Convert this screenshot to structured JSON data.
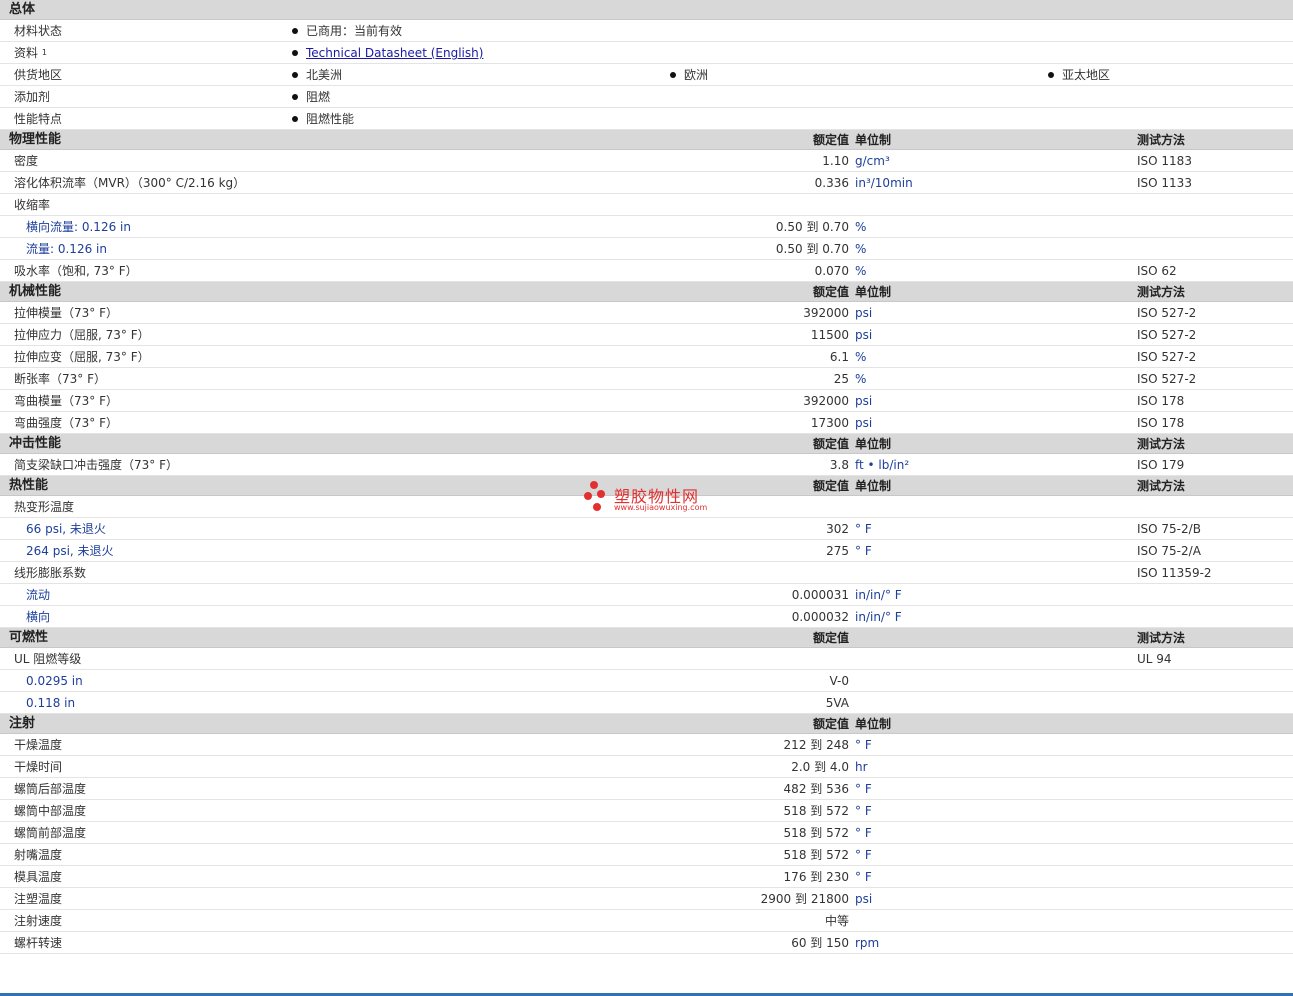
{
  "general": {
    "title": "总体",
    "rows": [
      {
        "label": "材料状态",
        "items": [
          "已商用：当前有效"
        ]
      },
      {
        "label": "资料",
        "sup": "1",
        "link": "Technical Datasheet (English)"
      },
      {
        "label": "供货地区",
        "items": [
          "北美洲",
          "欧洲",
          "亚太地区"
        ]
      },
      {
        "label": "添加剂",
        "items": [
          "阻燃"
        ]
      },
      {
        "label": "性能特点",
        "items": [
          "阻燃性能"
        ]
      }
    ]
  },
  "headers": {
    "value": "额定值",
    "unit": "单位制",
    "method": "测试方法"
  },
  "sections": [
    {
      "title": "物理性能",
      "show_unit": true,
      "show_method": true,
      "rows": [
        {
          "label": "密度",
          "value": "1.10",
          "unit": "g/cm³",
          "method": "ISO 1183"
        },
        {
          "label": "溶化体积流率（MVR）（300° C/2.16 kg）",
          "value": "0.336",
          "unit": "in³/10min",
          "method": "ISO 1133"
        },
        {
          "label": "收缩率",
          "value": "",
          "unit": "",
          "method": ""
        },
        {
          "label": "横向流量: 0.126 in",
          "sub": true,
          "value": "0.50 到  0.70",
          "unit": "%",
          "method": ""
        },
        {
          "label": "流量: 0.126 in",
          "sub": true,
          "value": "0.50 到  0.70",
          "unit": "%",
          "method": ""
        },
        {
          "label": "吸水率（饱和, 73° F）",
          "value": "0.070",
          "unit": "%",
          "method": "ISO 62"
        }
      ]
    },
    {
      "title": "机械性能",
      "show_unit": true,
      "show_method": true,
      "rows": [
        {
          "label": "拉伸模量（73° F）",
          "value": "392000",
          "unit": "psi",
          "method": "ISO 527-2"
        },
        {
          "label": "拉伸应力（屈服, 73° F）",
          "value": "11500",
          "unit": "psi",
          "method": "ISO 527-2"
        },
        {
          "label": "拉伸应变（屈服, 73° F）",
          "value": "6.1",
          "unit": "%",
          "method": "ISO 527-2"
        },
        {
          "label": "断张率（73° F）",
          "value": "25",
          "unit": "%",
          "method": "ISO 527-2"
        },
        {
          "label": "弯曲模量（73° F）",
          "value": "392000",
          "unit": "psi",
          "method": "ISO 178"
        },
        {
          "label": "弯曲强度（73° F）",
          "value": "17300",
          "unit": "psi",
          "method": "ISO 178"
        }
      ]
    },
    {
      "title": "冲击性能",
      "show_unit": true,
      "show_method": true,
      "rows": [
        {
          "label": "简支梁缺口冲击强度（73° F）",
          "value": "3.8",
          "unit": "ft • lb/in²",
          "method": "ISO 179"
        }
      ]
    },
    {
      "title": "热性能",
      "show_unit": true,
      "show_method": true,
      "rows": [
        {
          "label": "热变形温度",
          "value": "",
          "unit": "",
          "method": ""
        },
        {
          "label": "66 psi, 未退火",
          "sub": true,
          "value": "302",
          "unit": "° F",
          "method": "ISO 75-2/B"
        },
        {
          "label": "264 psi, 未退火",
          "sub": true,
          "value": "275",
          "unit": "° F",
          "method": "ISO 75-2/A"
        },
        {
          "label": "线形膨胀系数",
          "value": "",
          "unit": "",
          "method": "ISO 11359-2"
        },
        {
          "label": "流动",
          "sub": true,
          "value": "0.000031",
          "unit": "in/in/° F",
          "method": ""
        },
        {
          "label": "横向",
          "sub": true,
          "value": "0.000032",
          "unit": "in/in/° F",
          "method": ""
        }
      ]
    },
    {
      "title": "可燃性",
      "show_unit": false,
      "show_method": true,
      "rows": [
        {
          "label": "UL 阻燃等级",
          "value": "",
          "unit": "",
          "method": "UL 94"
        },
        {
          "label": "0.0295 in",
          "sub": true,
          "value": "V-0",
          "unit": "",
          "method": ""
        },
        {
          "label": "0.118 in",
          "sub": true,
          "value": "5VA",
          "unit": "",
          "method": ""
        }
      ]
    },
    {
      "title": "注射",
      "show_unit": true,
      "show_method": false,
      "rows": [
        {
          "label": "干燥温度",
          "value": "212 到  248",
          "unit": "° F",
          "method": ""
        },
        {
          "label": "干燥时间",
          "value": "2.0 到  4.0",
          "unit": "hr",
          "method": ""
        },
        {
          "label": "螺筒后部温度",
          "value": "482 到  536",
          "unit": "° F",
          "method": ""
        },
        {
          "label": "螺筒中部温度",
          "value": "518 到  572",
          "unit": "° F",
          "method": ""
        },
        {
          "label": "螺筒前部温度",
          "value": "518 到  572",
          "unit": "° F",
          "method": ""
        },
        {
          "label": "射嘴温度",
          "value": "518 到  572",
          "unit": "° F",
          "method": ""
        },
        {
          "label": "模具温度",
          "value": "176 到  230",
          "unit": "° F",
          "method": ""
        },
        {
          "label": "注塑温度",
          "value": "2900 到  21800",
          "unit": "psi",
          "method": ""
        },
        {
          "label": "注射速度",
          "value": "中等",
          "unit": "",
          "method": ""
        },
        {
          "label": "螺杆转速",
          "value": "60 到  150",
          "unit": "rpm",
          "method": ""
        }
      ]
    }
  ],
  "watermark": {
    "text": "塑胶物性网",
    "url": "www.sujiaowuxing.com"
  },
  "colors": {
    "section_bg": "#d8d8d8",
    "accent_blue": "#1d3f9b",
    "watermark_red": "#e23030"
  }
}
